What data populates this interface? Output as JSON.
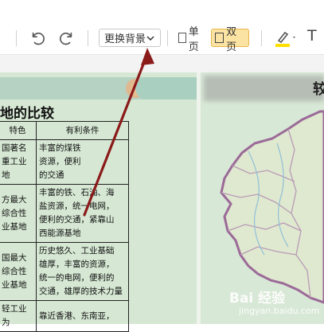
{
  "toolbar": {
    "background_label": "更换背景",
    "single_page_label": "单页",
    "double_page_label": "双页",
    "text_tool_label": "T",
    "highlight_color": "#ffe000",
    "active_view_color": "#fbe3a3"
  },
  "document": {
    "heading": "地的比较",
    "table": {
      "headers": [
        "特色",
        "有利条件"
      ],
      "rows": [
        {
          "feature": "国著名\n重工业\n地",
          "conditions": "丰富的煤铁\n资源，便利\n的交通"
        },
        {
          "feature": "方最大\n综合性\n业基地",
          "conditions": "丰富的铁、石油、海\n盐资源，统一电网，\n便利的交通，紧靠山\n西能源基地"
        },
        {
          "feature": "国最大\n综合性\n业基地",
          "conditions": "历史悠久、工业基础\n雄厚，丰富的资源，\n统一的电网，便利的\n交通，雄厚的技术力量"
        },
        {
          "feature": "轻工业为",
          "conditions": "靠近香港、东南亚，"
        }
      ]
    },
    "right_title_edge": "较"
  },
  "watermark": {
    "brand": "Bai 经验",
    "sub": "jingyan.baidu.com"
  },
  "colors": {
    "page_bg": "#d6e8d4",
    "banner": "#b6d2c3",
    "arrow": "#8b1a1a",
    "map_border": "#9b6a98"
  }
}
